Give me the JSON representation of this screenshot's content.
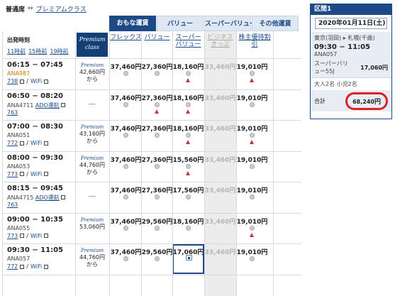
{
  "breadcrumb": {
    "current": "普通席",
    "arrow": "↔",
    "link": "プレミアムクラス"
  },
  "tabs": [
    {
      "label": "おもな運賃"
    },
    {
      "label": "バリュー"
    },
    {
      "label": "スーパーバリュー"
    },
    {
      "label": "その他運賃"
    }
  ],
  "header": {
    "departure_time": "出発時刻",
    "sort": [
      "11時前",
      "15時前",
      "19時前"
    ],
    "premium_line1": "Premium",
    "premium_line2": "class",
    "fares": [
      {
        "l1": "フレックス",
        "l2": ""
      },
      {
        "l1": "バリュー",
        "l2": ""
      },
      {
        "l1": "スーパー",
        "l2": "バリュー"
      },
      {
        "l1": "ビジネス",
        "l2": "きっぷ"
      },
      {
        "l1": "株主優待割引",
        "l2": ""
      }
    ]
  },
  "flights": [
    {
      "time": "06:15 − 07:45",
      "code": "ANA987",
      "code_orange": true,
      "meta": "738",
      "wifi": "WiFi",
      "premium": "42,660円",
      "from": "から",
      "prices": [
        "37,460円",
        "27,360円",
        "18,160円",
        "33,460円",
        "19,010円"
      ],
      "marks": [
        "r",
        "r",
        "t",
        "",
        "t"
      ]
    },
    {
      "time": "06:50 − 08:20",
      "code": "ANA4711",
      "partner": "ADO運航",
      "meta": "763",
      "wifi": "",
      "premium": "",
      "from": "",
      "prices": [
        "37,460円",
        "27,360円",
        "18,160円",
        "33,460円",
        "19,010円"
      ],
      "marks": [
        "r",
        "t",
        "t",
        "",
        "r"
      ]
    },
    {
      "time": "07:00 − 08:30",
      "code": "ANA051",
      "meta": "772",
      "wifi": "WiFi",
      "premium": "43,160円",
      "from": "から",
      "prices": [
        "37,460円",
        "27,360円",
        "18,160円",
        "33,460円",
        "19,010円"
      ],
      "marks": [
        "r",
        "r",
        "t",
        "",
        "t"
      ]
    },
    {
      "time": "08:00 − 09:30",
      "code": "ANA053",
      "meta": "773",
      "wifi": "WiFi",
      "premium": "44,760円",
      "from": "から",
      "prices": [
        "37,460円",
        "27,360円",
        "15,560円",
        "33,460円",
        "19,010円"
      ],
      "marks": [
        "r",
        "r",
        "t",
        "",
        "r"
      ]
    },
    {
      "time": "08:15 − 09:45",
      "code": "ANA4715",
      "partner": "ADO運航",
      "meta": "763",
      "wifi": "",
      "premium": "",
      "from": "",
      "prices": [
        "37,460円",
        "27,360円",
        "17,560円",
        "33,460円",
        "19,010円"
      ],
      "marks": [
        "r",
        "r",
        "r",
        "",
        "r"
      ]
    },
    {
      "time": "09:00 − 10:35",
      "code": "ANA055",
      "meta": "773",
      "wifi": "WiFi",
      "premium": "53,060円",
      "from": "",
      "prices": [
        "37,460円",
        "29,560円",
        "18,160円",
        "33,460円",
        "19,010円"
      ],
      "marks": [
        "r",
        "r",
        "r",
        "",
        "t"
      ]
    },
    {
      "time": "09:30 − 11:05",
      "code": "ANA057",
      "meta": "772",
      "wifi": "WiFi",
      "premium": "44,760円",
      "from": "から",
      "prices": [
        "37,460円",
        "29,560円",
        "17,060円",
        "33,460円",
        "19,010円"
      ],
      "marks": [
        "r",
        "r",
        "c",
        "",
        "r"
      ]
    }
  ],
  "summary": {
    "header": "区間1",
    "date": "2020年01月11日(土)",
    "route": "東京(羽田) ▸ 札幌(千歳)",
    "time": "09:30 − 11:05",
    "flight": "ANA057",
    "fare_name": "スーパーバリ",
    "fare_name2": "ュー55J",
    "fare_price": "17,060円",
    "passengers": "大人2名 小児2名",
    "total_label": "合計",
    "total_amount": "68,240",
    "total_unit": "円"
  },
  "colors": {
    "accent": "#1d4a86",
    "link": "#1a4a8a",
    "alert": "#e02020"
  }
}
